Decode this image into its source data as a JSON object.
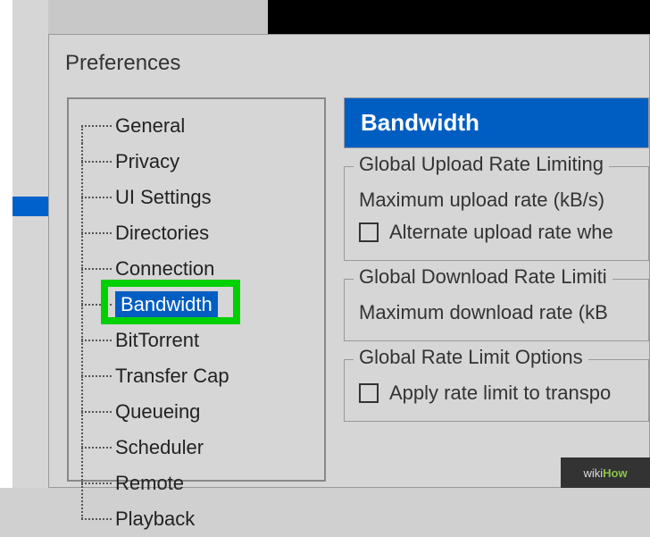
{
  "window": {
    "title": "Preferences"
  },
  "tree": {
    "items": [
      {
        "label": "General",
        "selected": false
      },
      {
        "label": "Privacy",
        "selected": false
      },
      {
        "label": "UI Settings",
        "selected": false
      },
      {
        "label": "Directories",
        "selected": false
      },
      {
        "label": "Connection",
        "selected": false
      },
      {
        "label": "Bandwidth",
        "selected": true
      },
      {
        "label": "BitTorrent",
        "selected": false
      },
      {
        "label": "Transfer Cap",
        "selected": false
      },
      {
        "label": "Queueing",
        "selected": false
      },
      {
        "label": "Scheduler",
        "selected": false
      },
      {
        "label": "Remote",
        "selected": false
      },
      {
        "label": "Playback",
        "selected": false
      }
    ]
  },
  "content": {
    "header": "Bandwidth",
    "upload_group": {
      "title": "Global Upload Rate Limiting",
      "max_label": "Maximum upload rate (kB/s)",
      "alt_label": "Alternate upload rate whe"
    },
    "download_group": {
      "title": "Global Download Rate Limiti",
      "max_label": "Maximum download rate (kB"
    },
    "limit_group": {
      "title": "Global Rate Limit Options",
      "apply_label": "Apply rate limit to transpo"
    }
  },
  "watermark": {
    "prefix": "wiki",
    "suffix": "How"
  }
}
